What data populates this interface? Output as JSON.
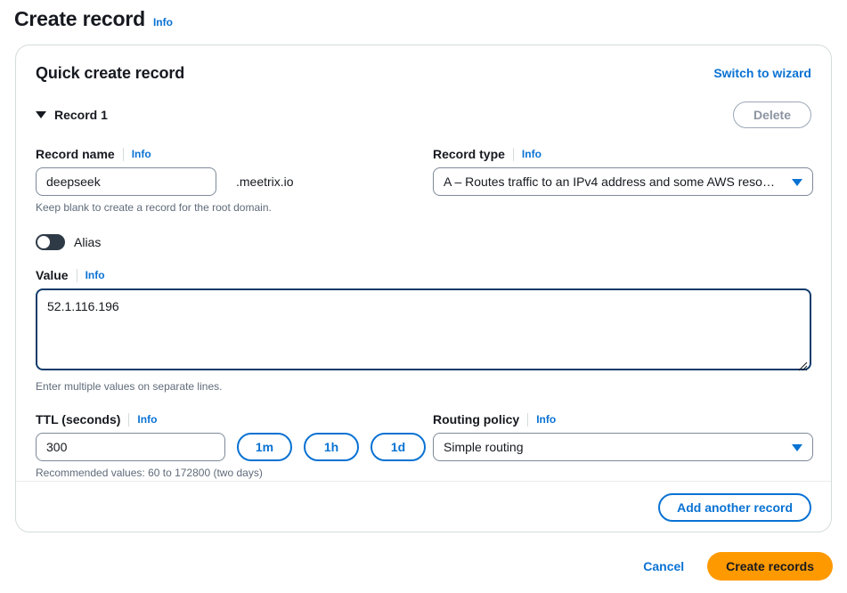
{
  "page": {
    "title": "Create record",
    "info_label": "Info"
  },
  "card": {
    "title": "Quick create record",
    "switch_label": "Switch to wizard",
    "record": {
      "label": "Record 1",
      "delete_label": "Delete",
      "expanded": true
    },
    "fields": {
      "record_name": {
        "label": "Record name",
        "info_label": "Info",
        "value": "deepseek",
        "placeholder": "",
        "suffix": ".meetrix.io",
        "hint": "Keep blank to create a record for the root domain."
      },
      "record_type": {
        "label": "Record type",
        "info_label": "Info",
        "selected": "A – Routes traffic to an IPv4 address and some AWS reso…"
      },
      "alias": {
        "label": "Alias",
        "enabled": false
      },
      "value": {
        "label": "Value",
        "info_label": "Info",
        "value": "52.1.116.196",
        "placeholder": "",
        "hint": "Enter multiple values on separate lines."
      },
      "ttl": {
        "label": "TTL (seconds)",
        "info_label": "Info",
        "value": "300",
        "placeholder": "",
        "hint": "Recommended values: 60 to 172800 (two days)",
        "quick_buttons": [
          {
            "label": "1m"
          },
          {
            "label": "1h"
          },
          {
            "label": "1d"
          }
        ]
      },
      "routing_policy": {
        "label": "Routing policy",
        "info_label": "Info",
        "selected": "Simple routing"
      }
    },
    "add_another_label": "Add another record"
  },
  "footer": {
    "cancel_label": "Cancel",
    "create_label": "Create records"
  },
  "colors": {
    "accent_blue": "#0972d3",
    "primary_orange": "#ff9900",
    "toggle_off": "#2f3a47",
    "focus_border": "#0f3b6b",
    "text": "#16191f",
    "muted_text": "#5f6b7a",
    "border": "#d5dbdb"
  },
  "icons": {
    "caret_down": "chevron-down-icon",
    "select_caret": "chevron-down-icon",
    "resize_grip": "resize-handle-icon"
  }
}
